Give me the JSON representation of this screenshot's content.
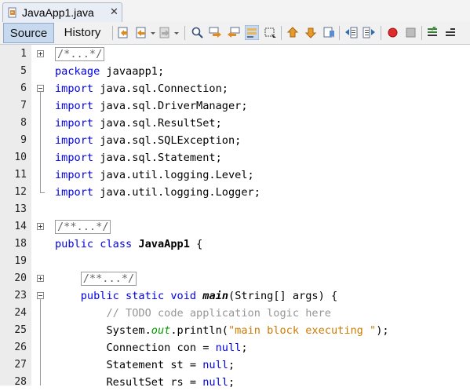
{
  "tab": {
    "file_name": "JavaApp1.java",
    "close_glyph": "✕"
  },
  "view_tabs": {
    "source": "Source",
    "history": "History"
  },
  "toolbar_icons": [
    "last-edit-icon",
    "back-icon",
    "forward-icon",
    "find-selection-icon",
    "find-previous-icon",
    "find-next-icon",
    "toggle-highlight-icon",
    "toggle-rect-selection-icon",
    "previous-bookmark-icon",
    "next-bookmark-icon",
    "toggle-bookmark-icon",
    "shift-left-icon",
    "shift-right-icon",
    "start-macro-icon",
    "stop-macro-icon",
    "comment-icon",
    "uncomment-icon"
  ],
  "lines": [
    {
      "num": "1",
      "fold": "plus",
      "segments": [
        {
          "t": "/*...*/",
          "c": "collapsed"
        }
      ]
    },
    {
      "num": "5",
      "segments": [
        {
          "t": "package",
          "c": "kw"
        },
        {
          "t": " javaapp1;"
        }
      ]
    },
    {
      "num": "6",
      "fold": "minus",
      "segments": [
        {
          "t": "import",
          "c": "kw"
        },
        {
          "t": " java.sql.Connection;"
        }
      ]
    },
    {
      "num": "7",
      "segments": [
        {
          "t": "import",
          "c": "kw"
        },
        {
          "t": " java.sql.DriverManager;"
        }
      ]
    },
    {
      "num": "8",
      "segments": [
        {
          "t": "import",
          "c": "kw"
        },
        {
          "t": " java.sql.ResultSet;"
        }
      ]
    },
    {
      "num": "9",
      "segments": [
        {
          "t": "import",
          "c": "kw"
        },
        {
          "t": " java.sql.SQLException;"
        }
      ]
    },
    {
      "num": "10",
      "segments": [
        {
          "t": "import",
          "c": "kw"
        },
        {
          "t": " java.sql.Statement;"
        }
      ]
    },
    {
      "num": "11",
      "segments": [
        {
          "t": "import",
          "c": "kw"
        },
        {
          "t": " java.util.logging.Level;"
        }
      ]
    },
    {
      "num": "12",
      "fold": "end",
      "segments": [
        {
          "t": "import",
          "c": "kw"
        },
        {
          "t": " java.util.logging.Logger;"
        }
      ]
    },
    {
      "num": "13",
      "segments": []
    },
    {
      "num": "14",
      "fold": "plus",
      "segments": [
        {
          "t": "/**...*/",
          "c": "collapsed"
        }
      ]
    },
    {
      "num": "18",
      "segments": [
        {
          "t": "public",
          "c": "kw"
        },
        {
          "t": " "
        },
        {
          "t": "class",
          "c": "kw"
        },
        {
          "t": " "
        },
        {
          "t": "JavaApp1",
          "c": "cls"
        },
        {
          "t": " {"
        }
      ]
    },
    {
      "num": "19",
      "segments": []
    },
    {
      "num": "20",
      "fold": "plus",
      "segments": [
        {
          "t": "    "
        },
        {
          "t": "/**...*/",
          "c": "collapsed"
        }
      ]
    },
    {
      "num": "23",
      "fold": "minus",
      "segments": [
        {
          "t": "    "
        },
        {
          "t": "public",
          "c": "kw"
        },
        {
          "t": " "
        },
        {
          "t": "static",
          "c": "kw"
        },
        {
          "t": " "
        },
        {
          "t": "void",
          "c": "kw"
        },
        {
          "t": " "
        },
        {
          "t": "main",
          "c": "mth"
        },
        {
          "t": "(String[] args) {"
        }
      ]
    },
    {
      "num": "24",
      "segments": [
        {
          "t": "        "
        },
        {
          "t": "// TODO code application logic here",
          "c": "cm"
        }
      ]
    },
    {
      "num": "25",
      "segments": [
        {
          "t": "        System."
        },
        {
          "t": "out",
          "c": "fld"
        },
        {
          "t": ".println("
        },
        {
          "t": "\"main block executing \"",
          "c": "str"
        },
        {
          "t": ");"
        }
      ]
    },
    {
      "num": "26",
      "segments": [
        {
          "t": "        Connection con = "
        },
        {
          "t": "null",
          "c": "kw"
        },
        {
          "t": ";"
        }
      ]
    },
    {
      "num": "27",
      "segments": [
        {
          "t": "        Statement st = "
        },
        {
          "t": "null",
          "c": "kw"
        },
        {
          "t": ";"
        }
      ]
    },
    {
      "num": "28",
      "segments": [
        {
          "t": "        ResultSet rs = "
        },
        {
          "t": "null",
          "c": "kw"
        },
        {
          "t": ";"
        }
      ]
    }
  ]
}
